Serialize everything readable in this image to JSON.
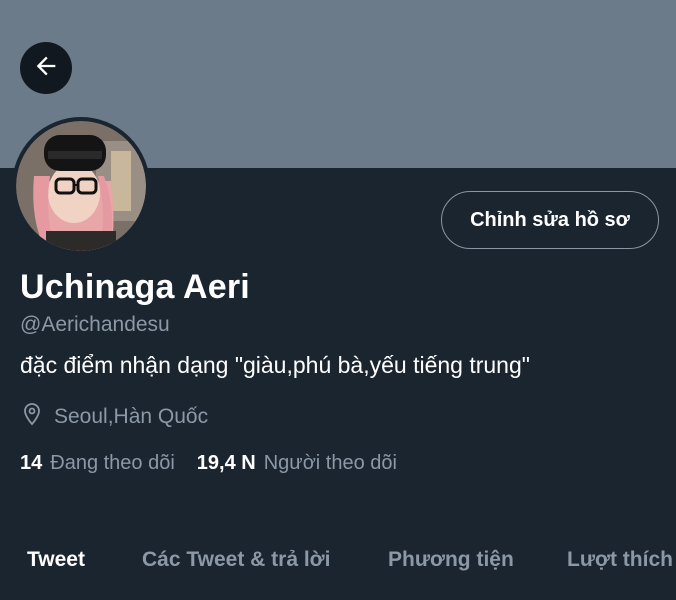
{
  "header": {
    "back_icon": "arrow-left-icon"
  },
  "profile": {
    "edit_button": "Chỉnh sửa hồ sơ",
    "display_name": "Uchinaga Aeri",
    "handle": "@Aerichandesu",
    "bio": "đặc điểm nhận dạng \"giàu,phú bà,yếu tiếng trung\"",
    "location": "Seoul,Hàn Quốc",
    "following_count": "14",
    "following_label": "Đang theo dõi",
    "followers_count": "19,4 N",
    "followers_label": "Người theo dõi"
  },
  "tabs": [
    {
      "label": "Tweet",
      "active": true
    },
    {
      "label": "Các Tweet & trả lời",
      "active": false
    },
    {
      "label": "Phương tiện",
      "active": false
    },
    {
      "label": "Lượt thích",
      "active": false
    }
  ],
  "colors": {
    "banner": "#6b7b89",
    "background": "#1b2530",
    "text_primary": "#ffffff",
    "text_secondary": "#8b98a5"
  }
}
